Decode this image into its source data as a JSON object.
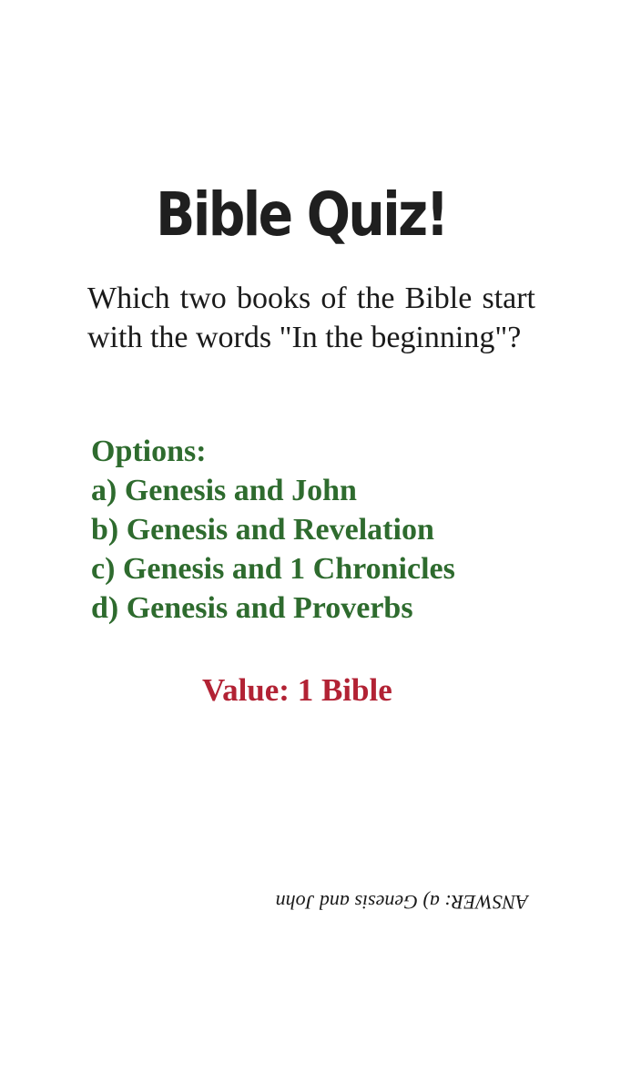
{
  "card": {
    "title": "Bible Quiz!",
    "question": "Which two books of the Bible start with the words \"In the beginning\"?",
    "options_heading": "Options:",
    "options": [
      "a) Genesis and John",
      "b) Genesis and Revelation",
      "c) Genesis and 1 Chronicles",
      "d) Genesis and Proverbs"
    ],
    "value": "Value: 1 Bible",
    "answer": "ANSWER: a) Genesis and John"
  },
  "colors": {
    "title": "#1f1f1f",
    "options": "#2e6b2e",
    "value": "#b22234",
    "background": "#ffffff"
  }
}
